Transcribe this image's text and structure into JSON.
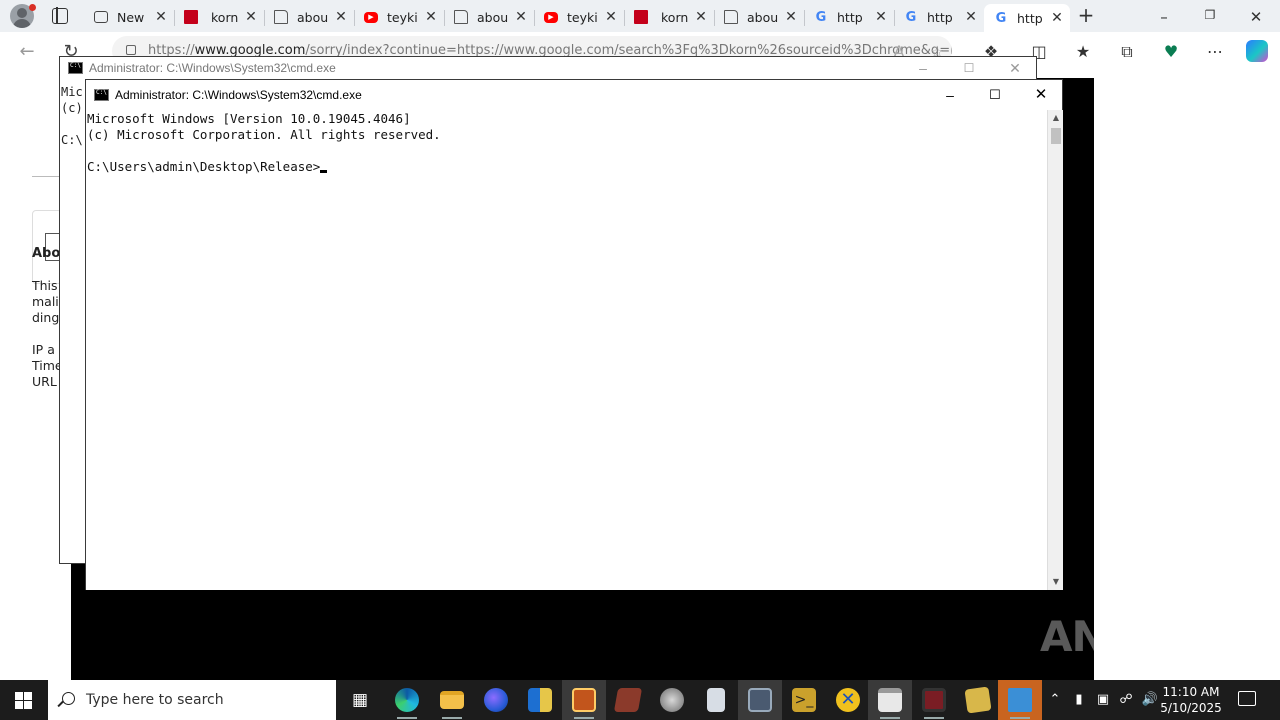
{
  "browser": {
    "tabs": [
      {
        "icon": "new-tab-icon",
        "title": "New"
      },
      {
        "icon": "korn-favicon",
        "title": "korn"
      },
      {
        "icon": "page-icon",
        "title": "abou"
      },
      {
        "icon": "youtube-icon",
        "title": "teyki"
      },
      {
        "icon": "page-icon",
        "title": "abou"
      },
      {
        "icon": "youtube-icon",
        "title": "teyki"
      },
      {
        "icon": "korn-favicon",
        "title": "korn"
      },
      {
        "icon": "page-icon",
        "title": "abou"
      },
      {
        "icon": "google-icon",
        "title": "http"
      },
      {
        "icon": "google-icon",
        "title": "http"
      },
      {
        "icon": "google-icon",
        "title": "http",
        "active": true
      }
    ],
    "address_prefix": "https://",
    "address_host": "www.google.com",
    "address_rest": "/sorry/index?continue=https://www.google.com/search%3Fq%3Dkorn%26sourceid%3Dchrome&q=EgRUFT"
  },
  "page_behind": {
    "lines": [
      "Abo",
      "This",
      "malic",
      "ding",
      "IP a",
      "Time",
      "URL"
    ]
  },
  "cmd_back": {
    "title": "Administrator: C:\\Windows\\System32\\cmd.exe",
    "lines": [
      "Mic",
      "(c)",
      "C:\\"
    ]
  },
  "cmd_front": {
    "title": "Administrator: C:\\Windows\\System32\\cmd.exe",
    "line1": "Microsoft Windows [Version 10.0.19045.4046]",
    "line2": "(c) Microsoft Corporation. All rights reserved.",
    "prompt": "C:\\Users\\admin\\Desktop\\Release>"
  },
  "watermark": "ANY RUN",
  "taskbar": {
    "search_placeholder": "Type here to search",
    "time": "11:10 AM",
    "date": "5/10/2025"
  },
  "colors": {
    "taskbar": "#1c1c1c",
    "tabstrip": "#edf0f3",
    "console_bg": "#ffffff"
  }
}
